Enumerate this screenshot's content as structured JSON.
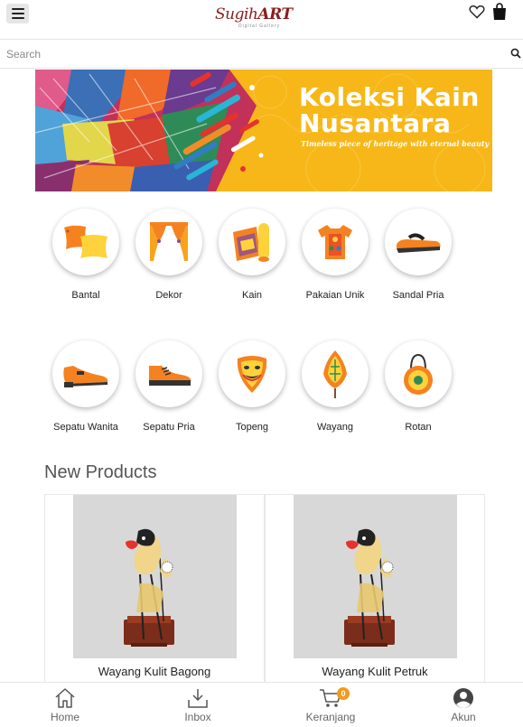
{
  "header": {
    "logo_main": "Sugih",
    "logo_accent": "ART",
    "logo_sub": "Digital Gallery"
  },
  "search": {
    "placeholder": "Search"
  },
  "banner": {
    "title_line1": "Koleksi Kain",
    "title_line2": "Nusantara",
    "tagline": "Timeless piece of heritage with eternal beauty"
  },
  "categories": [
    {
      "label": "Bantal",
      "icon": "pillow-icon"
    },
    {
      "label": "Dekor",
      "icon": "curtain-icon"
    },
    {
      "label": "Kain",
      "icon": "fabric-roll-icon"
    },
    {
      "label": "Pakaian Unik",
      "icon": "shirt-icon"
    },
    {
      "label": "Sandal Pria",
      "icon": "sandal-icon"
    },
    {
      "label": "Sepatu Wanita",
      "icon": "womens-shoe-icon"
    },
    {
      "label": "Sepatu Pria",
      "icon": "mens-shoe-icon"
    },
    {
      "label": "Topeng",
      "icon": "mask-icon"
    },
    {
      "label": "Wayang",
      "icon": "wayang-icon"
    },
    {
      "label": "Rotan",
      "icon": "rattan-bag-icon"
    }
  ],
  "new_products": {
    "title": "New Products",
    "items": [
      {
        "name": "Wayang Kulit Bagong"
      },
      {
        "name": "Wayang Kulit Petruk"
      }
    ]
  },
  "bottom_nav": {
    "items": [
      {
        "label": "Home",
        "icon": "home-icon"
      },
      {
        "label": "Inbox",
        "icon": "inbox-icon"
      },
      {
        "label": "Keranjang",
        "icon": "cart-icon",
        "badge": "0"
      },
      {
        "label": "Akun",
        "icon": "account-icon"
      }
    ]
  },
  "colors": {
    "brand": "#8b1d1d",
    "accent": "#f5a623",
    "banner_bg": "#f7b718",
    "badge": "#f29a1a"
  }
}
